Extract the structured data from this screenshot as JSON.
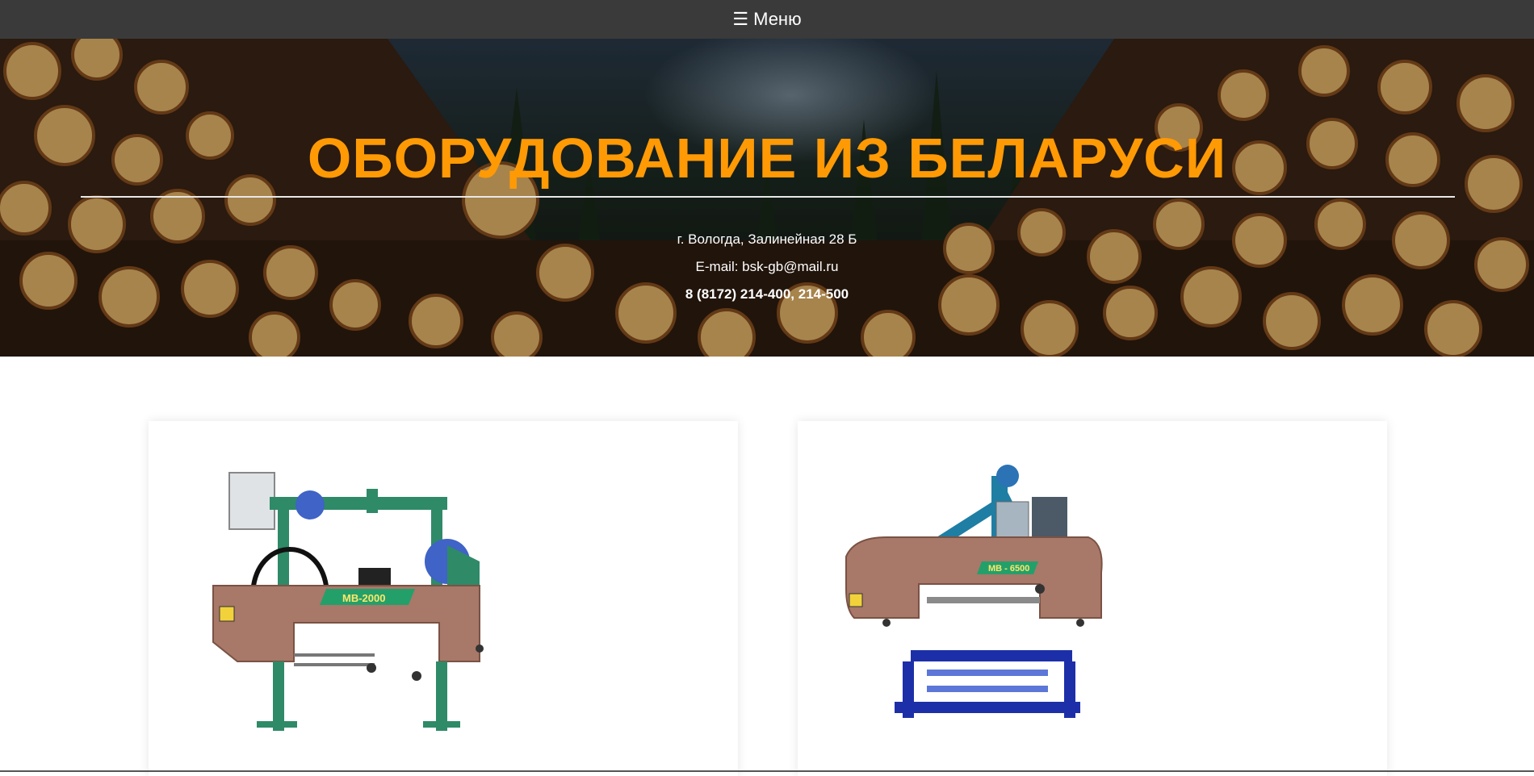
{
  "nav": {
    "menu_icon": "☰",
    "menu_label": "Меню"
  },
  "hero": {
    "title": "ОБОРУДОВАНИЕ ИЗ БЕЛАРУСИ",
    "address": "г. Вологда, Залинейная 28 Б",
    "email": "E-mail: bsk-gb@mail.ru",
    "phone": "8 (8172) 214-400, 214-500"
  },
  "products": [
    {
      "model": "МВ-2000"
    },
    {
      "model": "МВ - 6500"
    }
  ],
  "colors": {
    "accent": "#ff9a05",
    "nav_bg": "#3a3a3a"
  }
}
